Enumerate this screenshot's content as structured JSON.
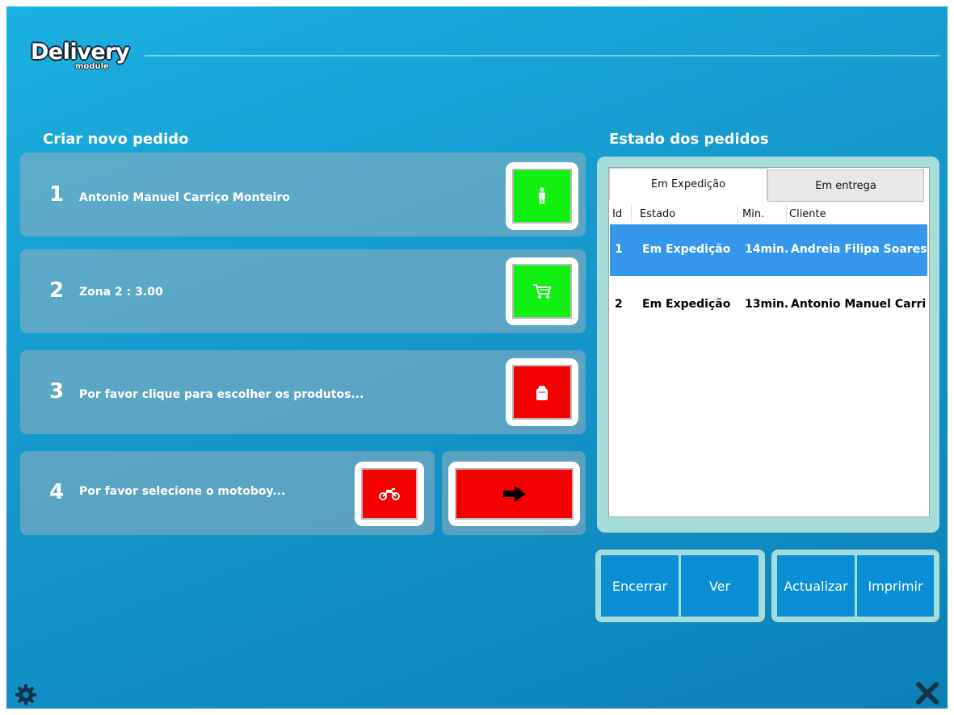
{
  "app": {
    "logo_main": "Delivery",
    "logo_sub": "module"
  },
  "create": {
    "title": "Criar novo pedido",
    "steps": [
      {
        "num": "1",
        "text": "Antonio Manuel Carriço Monteiro",
        "icon": "person-icon",
        "status": "green"
      },
      {
        "num": "2",
        "text": "Zona 2 : 3.00",
        "icon": "cart-icon",
        "status": "green"
      },
      {
        "num": "3",
        "text": "Por favor clique para escolher os produtos...",
        "icon": "bag-icon",
        "status": "red"
      },
      {
        "num": "4",
        "text": "Por favor selecione o motoboy...",
        "icon": "motorcycle-icon",
        "status": "red"
      }
    ],
    "next_icon": "arrow-right-icon"
  },
  "orders": {
    "title": "Estado dos pedidos",
    "tabs": [
      "Em Expedição",
      "Em entrega"
    ],
    "active_tab": "Em Expedição",
    "columns": [
      "Id",
      "Estado",
      "Min.",
      "Cliente"
    ],
    "rows": [
      {
        "id": "1",
        "estado": "Em Expedição",
        "min": "14min.",
        "cliente": "Andreia Filipa Soares Ro",
        "selected": true
      },
      {
        "id": "2",
        "estado": "Em Expedição",
        "min": "13min.",
        "cliente": "Antonio Manuel Carriço",
        "selected": false
      }
    ]
  },
  "actions": {
    "encerrar": "Encerrar",
    "ver": "Ver",
    "actualizar": "Actualizar",
    "imprimir": "Imprimir"
  },
  "colors": {
    "ok": "#12f012",
    "pending": "#f40000",
    "accent": "#0a8ed4",
    "selected_row": "#3597ec"
  },
  "icons": {
    "settings": "gear-icon",
    "close": "close-icon"
  }
}
